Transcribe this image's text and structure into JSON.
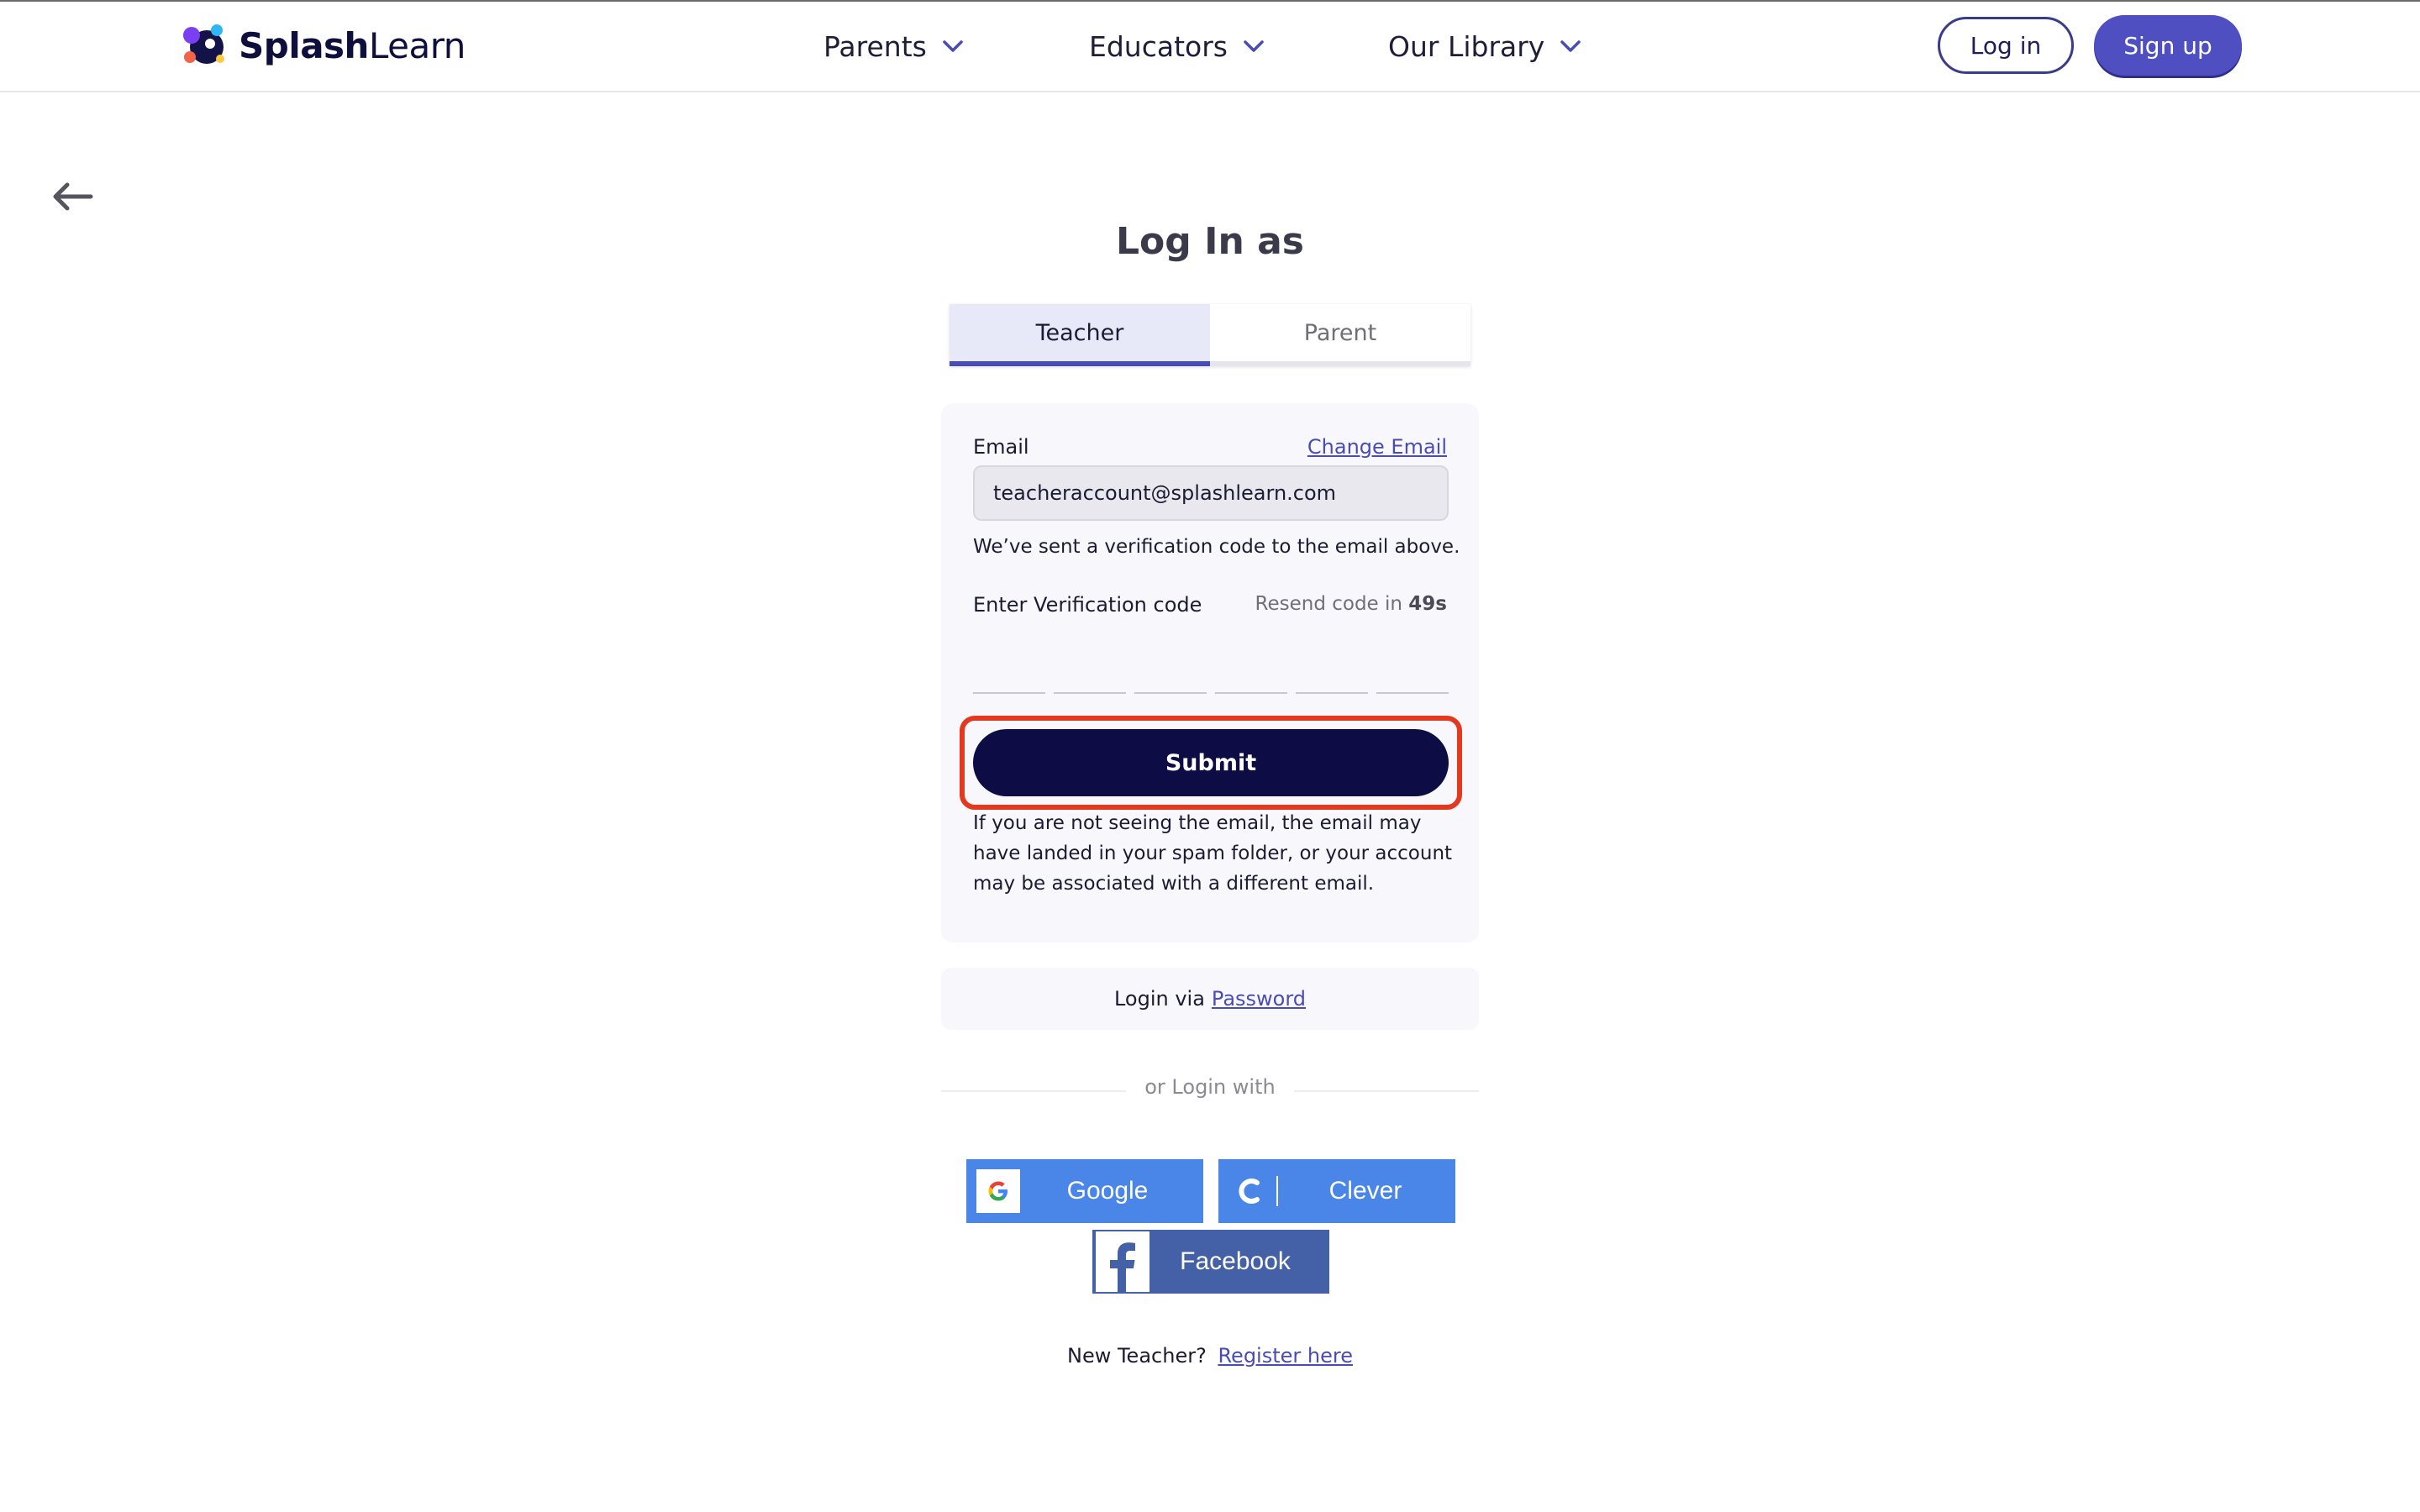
{
  "header": {
    "logo_bold": "Splash",
    "logo_light": "Learn",
    "nav": [
      {
        "label": "Parents"
      },
      {
        "label": "Educators"
      },
      {
        "label": "Our Library"
      }
    ],
    "login_label": "Log in",
    "signup_label": "Sign up"
  },
  "page": {
    "title": "Log In as",
    "tabs": [
      {
        "label": "Teacher",
        "active": true
      },
      {
        "label": "Parent",
        "active": false
      }
    ]
  },
  "form": {
    "email_label": "Email",
    "change_email_label": "Change Email",
    "email_value": "teacheraccount@splashlearn.com",
    "sent_message": "We’ve sent a verification code to the email above.",
    "code_label": "Enter Verification code",
    "resend_prefix": "Resend code in",
    "resend_seconds": "49s",
    "code_digits": [
      "",
      "",
      "",
      "",
      "",
      ""
    ],
    "submit_label": "Submit",
    "spam_note": "If you are not seeing the email, the email may have landed in your spam folder, or your account may be associated with a different email."
  },
  "alt_login": {
    "prefix": "Login via",
    "password_link": "Password",
    "or_login_with": "or Login with",
    "google_label": "Google",
    "clever_label": "Clever",
    "facebook_label": "Facebook"
  },
  "footer": {
    "new_teacher": "New Teacher?",
    "register_link": "Register here"
  },
  "colors": {
    "brand_navy": "#0d0c45",
    "brand_purple": "#4f4fc2",
    "highlight_red": "#e2391f",
    "google_blue": "#4a86e8",
    "facebook_blue": "#4461a8"
  },
  "icons": [
    "splashlearn-logo-icon",
    "chevron-down-icon",
    "back-arrow-icon",
    "google-icon",
    "clever-icon",
    "facebook-icon"
  ]
}
